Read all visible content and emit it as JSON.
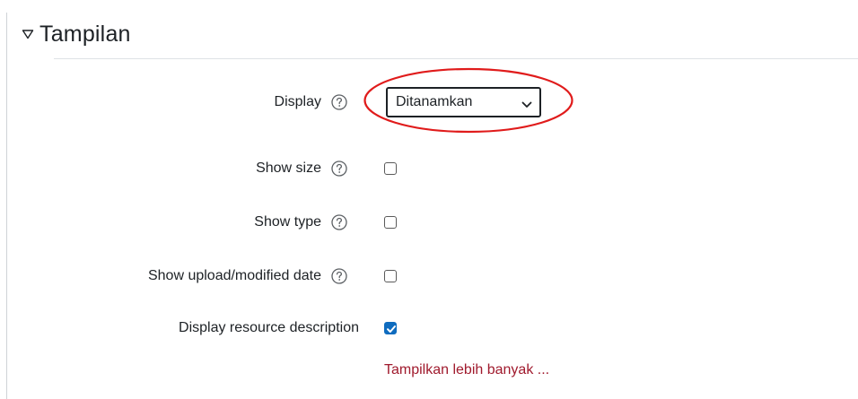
{
  "section": {
    "title": "Tampilan",
    "collapse_icon": "triangle-down-outline"
  },
  "display_field": {
    "label": "Display",
    "help_icon": "question-circle",
    "selected_value": "Ditanamkan",
    "highlight_color": "#e01b1b"
  },
  "fields": [
    {
      "label": "Show size",
      "help_icon": "question-circle",
      "checked": false
    },
    {
      "label": "Show type",
      "help_icon": "question-circle",
      "checked": false
    },
    {
      "label": "Show upload/modified date",
      "help_icon": "question-circle",
      "checked": false
    },
    {
      "label": "Display resource description",
      "checked": true
    }
  ],
  "show_more": {
    "label": "Tampilkan lebih banyak ..."
  },
  "colors": {
    "checkbox_checked": "#0f6cbf",
    "link": "#a01a2d",
    "text": "#1d2125"
  }
}
